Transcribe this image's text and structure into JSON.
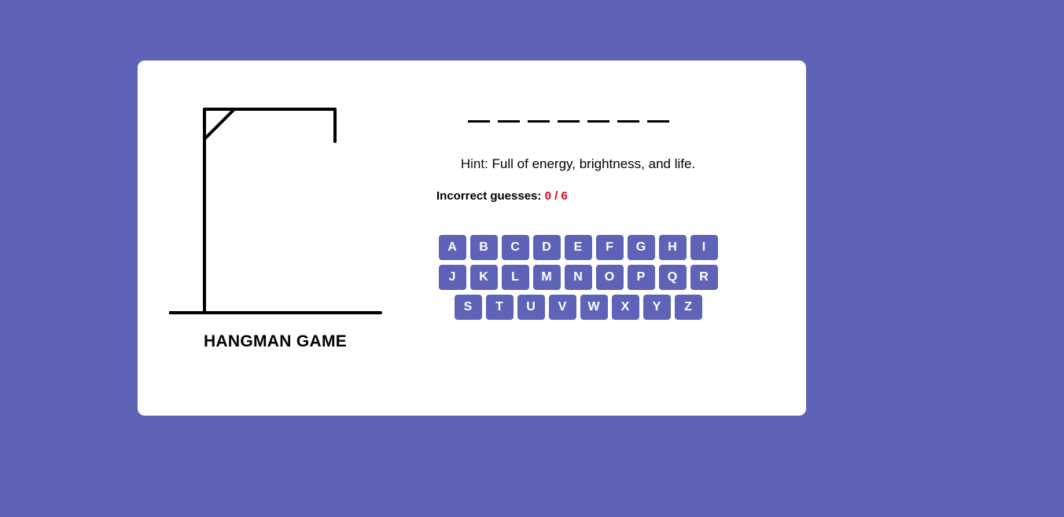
{
  "game": {
    "title": "HANGMAN GAME",
    "word_length": 7,
    "hint_label": "Hint:",
    "hint_text": "Full of energy, brightness, and life.",
    "guesses_label": "Incorrect guesses:",
    "guesses_count": "0 / 6",
    "incorrect": 0,
    "max_incorrect": 6
  },
  "keyboard": {
    "rows": [
      [
        "A",
        "B",
        "C",
        "D",
        "E",
        "F",
        "G",
        "H",
        "I"
      ],
      [
        "J",
        "K",
        "L",
        "M",
        "N",
        "O",
        "P",
        "Q",
        "R"
      ],
      [
        "S",
        "T",
        "U",
        "V",
        "W",
        "X",
        "Y",
        "Z"
      ]
    ]
  },
  "colors": {
    "background": "#5e63b8",
    "card": "#ffffff",
    "key_bg": "#5e63b8",
    "key_text": "#ffffff",
    "guess_count": "#e2001a"
  }
}
